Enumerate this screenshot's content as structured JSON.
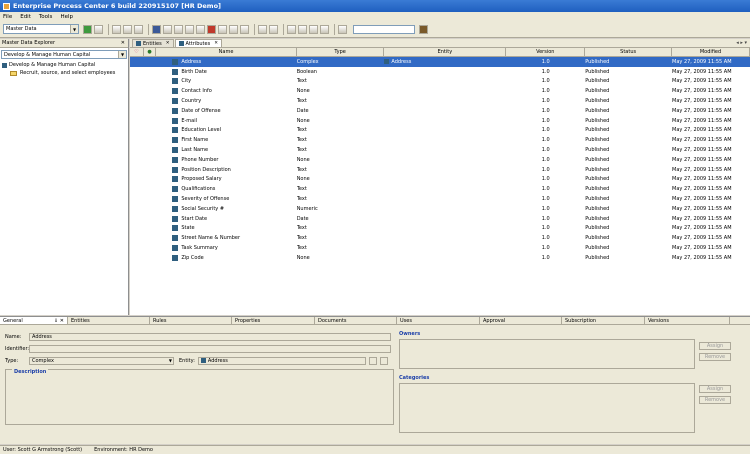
{
  "window": {
    "title": "Enterprise Process Center 6 build 220915107 [HR Demo]"
  },
  "menu": [
    "File",
    "Edit",
    "Tools",
    "Help"
  ],
  "toolbar": {
    "view_select": "Master Data"
  },
  "explorer": {
    "title": "Master Data Explorer",
    "selected": "Develop & Manage Human Capital",
    "tree": [
      {
        "label": "Develop & Manage Human Capital",
        "level": 0
      },
      {
        "label": "Recruit, source, and select employees",
        "level": 1
      }
    ]
  },
  "tabs": [
    {
      "label": "Entities"
    },
    {
      "label": "Attributes"
    }
  ],
  "grid": {
    "columns": [
      "Name",
      "Type",
      "Entity",
      "Version",
      "Status",
      "Modified"
    ],
    "rows": [
      {
        "name": "Address",
        "type": "Complex",
        "entity": "Address",
        "version": "1.0",
        "status": "Published",
        "modified": "May 27, 2009 11:55 AM"
      },
      {
        "name": "Birth Date",
        "type": "Boolean",
        "entity": "",
        "version": "1.0",
        "status": "Published",
        "modified": "May 27, 2009 11:55 AM"
      },
      {
        "name": "City",
        "type": "Text",
        "entity": "",
        "version": "1.0",
        "status": "Published",
        "modified": "May 27, 2009 11:55 AM"
      },
      {
        "name": "Contact Info",
        "type": "None",
        "entity": "",
        "version": "1.0",
        "status": "Published",
        "modified": "May 27, 2009 11:55 AM"
      },
      {
        "name": "Country",
        "type": "Text",
        "entity": "",
        "version": "1.0",
        "status": "Published",
        "modified": "May 27, 2009 11:55 AM"
      },
      {
        "name": "Date of Offense",
        "type": "Date",
        "entity": "",
        "version": "1.0",
        "status": "Published",
        "modified": "May 27, 2009 11:55 AM"
      },
      {
        "name": "E-mail",
        "type": "None",
        "entity": "",
        "version": "1.0",
        "status": "Published",
        "modified": "May 27, 2009 11:55 AM"
      },
      {
        "name": "Education Level",
        "type": "Text",
        "entity": "",
        "version": "1.0",
        "status": "Published",
        "modified": "May 27, 2009 11:55 AM"
      },
      {
        "name": "First Name",
        "type": "Text",
        "entity": "",
        "version": "1.0",
        "status": "Published",
        "modified": "May 27, 2009 11:55 AM"
      },
      {
        "name": "Last Name",
        "type": "Text",
        "entity": "",
        "version": "1.0",
        "status": "Published",
        "modified": "May 27, 2009 11:55 AM"
      },
      {
        "name": "Phone Number",
        "type": "None",
        "entity": "",
        "version": "1.0",
        "status": "Published",
        "modified": "May 27, 2009 11:55 AM"
      },
      {
        "name": "Position Description",
        "type": "Text",
        "entity": "",
        "version": "1.0",
        "status": "Published",
        "modified": "May 27, 2009 11:55 AM"
      },
      {
        "name": "Proposed Salary",
        "type": "None",
        "entity": "",
        "version": "1.0",
        "status": "Published",
        "modified": "May 27, 2009 11:55 AM"
      },
      {
        "name": "Qualifications",
        "type": "Text",
        "entity": "",
        "version": "1.0",
        "status": "Published",
        "modified": "May 27, 2009 11:55 AM"
      },
      {
        "name": "Severity of Offense",
        "type": "Text",
        "entity": "",
        "version": "1.0",
        "status": "Published",
        "modified": "May 27, 2009 11:55 AM"
      },
      {
        "name": "Social Security #",
        "type": "Numeric",
        "entity": "",
        "version": "1.0",
        "status": "Published",
        "modified": "May 27, 2009 11:55 AM"
      },
      {
        "name": "Start Date",
        "type": "Date",
        "entity": "",
        "version": "1.0",
        "status": "Published",
        "modified": "May 27, 2009 11:55 AM"
      },
      {
        "name": "State",
        "type": "Text",
        "entity": "",
        "version": "1.0",
        "status": "Published",
        "modified": "May 27, 2009 11:55 AM"
      },
      {
        "name": "Street Name & Number",
        "type": "Text",
        "entity": "",
        "version": "1.0",
        "status": "Published",
        "modified": "May 27, 2009 11:55 AM"
      },
      {
        "name": "Task Summary",
        "type": "Text",
        "entity": "",
        "version": "1.0",
        "status": "Published",
        "modified": "May 27, 2009 11:55 AM"
      },
      {
        "name": "Zip Code",
        "type": "None",
        "entity": "",
        "version": "1.0",
        "status": "Published",
        "modified": "May 27, 2009 11:55 AM"
      }
    ]
  },
  "bottom_tabs": [
    "General",
    "Entities",
    "Rules",
    "Properties",
    "Documents",
    "Uses",
    "Approval",
    "Subscription",
    "Versions"
  ],
  "form": {
    "name_label": "Name:",
    "name_value": "Address",
    "identifier_label": "Identifier:",
    "identifier_value": "",
    "type_label": "Type:",
    "type_value": "Complex",
    "entity_label": "Entity:",
    "entity_value": "Address",
    "description_title": "Description"
  },
  "owners": {
    "title": "Owners",
    "assign": "Assign",
    "remove": "Remove"
  },
  "categories": {
    "title": "Categories",
    "assign": "Assign",
    "remove": "Remove"
  },
  "status": {
    "user": "User: Scott G Armstrong (Scott)",
    "environment": "Environment: HR Demo"
  }
}
